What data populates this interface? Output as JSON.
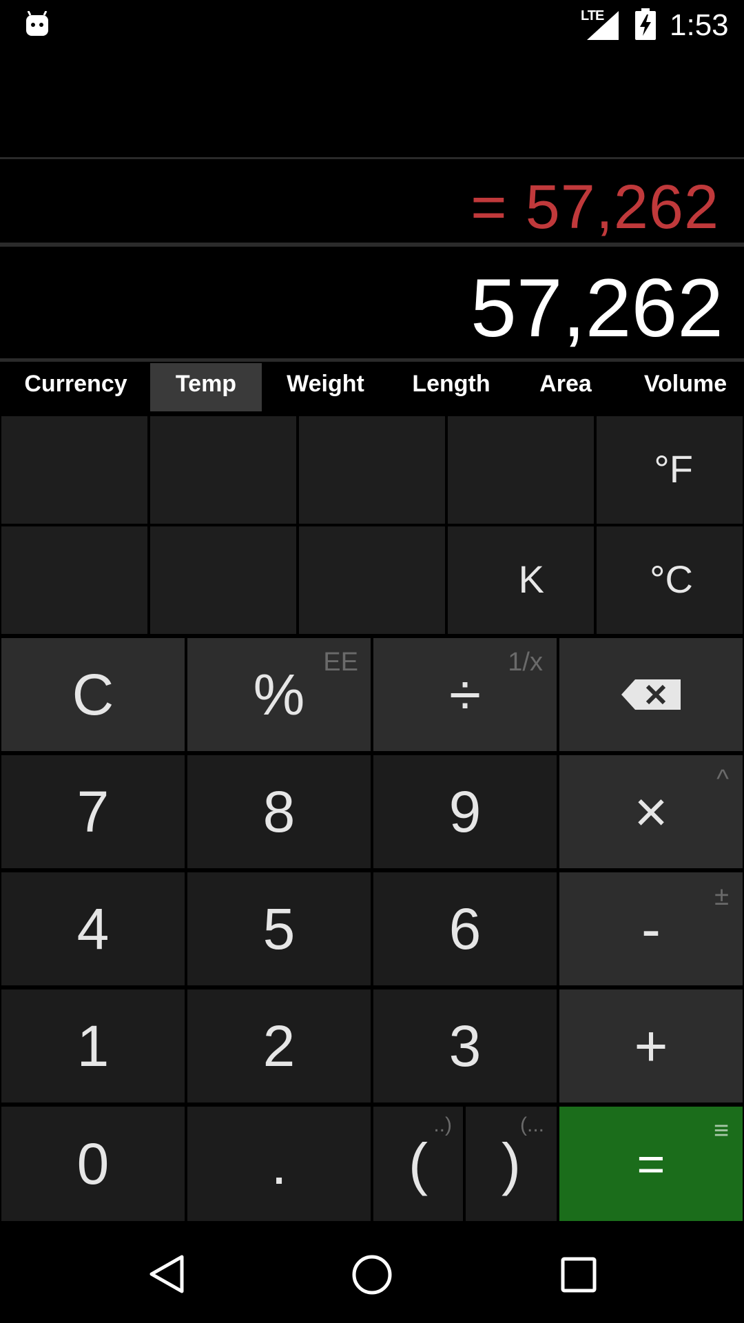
{
  "status_bar": {
    "network": "LTE",
    "time": "1:53"
  },
  "display": {
    "result": "= 57,262",
    "expression": "57,262"
  },
  "tabs": [
    {
      "label": "Currency",
      "active": false
    },
    {
      "label": "Temp",
      "active": true
    },
    {
      "label": "Weight",
      "active": false
    },
    {
      "label": "Length",
      "active": false
    },
    {
      "label": "Area",
      "active": false
    },
    {
      "label": "Volume",
      "active": false
    }
  ],
  "unit_keys": {
    "row1": [
      "",
      "",
      "",
      "",
      "°F"
    ],
    "row2": [
      "",
      "",
      "",
      "K",
      "°C"
    ]
  },
  "keys": {
    "clear": "C",
    "percent": "%",
    "percent_alt": "EE",
    "divide": "÷",
    "divide_alt": "1/x",
    "multiply": "×",
    "multiply_alt": "^",
    "minus": "-",
    "minus_alt": "±",
    "plus": "+",
    "seven": "7",
    "eight": "8",
    "nine": "9",
    "four": "4",
    "five": "5",
    "six": "6",
    "one": "1",
    "two": "2",
    "three": "3",
    "zero": "0",
    "dot": ".",
    "open_paren": "(",
    "open_paren_alt": "..)",
    "close_paren": ")",
    "close_paren_alt": "(...",
    "equals": "=",
    "equals_alt": "≡"
  },
  "colors": {
    "result": "#c0393b",
    "equals_key": "#1b6d1b",
    "operator_key": "#2d2d2d",
    "number_key": "#1c1c1c"
  }
}
